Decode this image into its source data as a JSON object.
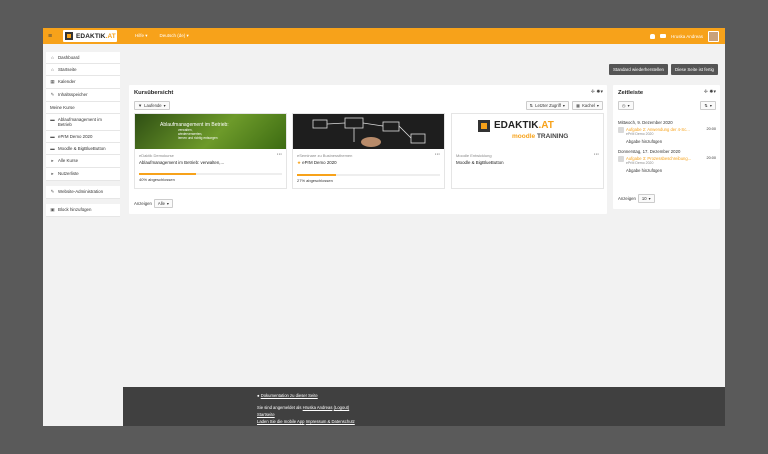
{
  "header": {
    "brand_main": "EDAKTIK",
    "brand_dot": ".AT",
    "menu": [
      "Hilfe ▾",
      "Deutsch (de) ▾"
    ],
    "user_name": "Hruska Andreas"
  },
  "sidebar": {
    "items": [
      {
        "icon": "⌂",
        "label": "Dashboard"
      },
      {
        "icon": "⌂",
        "label": "Startseite"
      },
      {
        "icon": "▦",
        "label": "Kalender"
      },
      {
        "icon": "✎",
        "label": "Inhaltsspeicher"
      },
      {
        "icon": "",
        "label": "Meine Kurse"
      },
      {
        "icon": "▬",
        "label": "Ablaufmanagement im Betrieb"
      },
      {
        "icon": "▬",
        "label": "ePrM Demo 2020"
      },
      {
        "icon": "▬",
        "label": "Moodle & BigBlueButton"
      },
      {
        "icon": "▸",
        "label": "Alle Kurse"
      },
      {
        "icon": "▸",
        "label": "Nutzerliste"
      },
      {
        "icon": "✎",
        "label": "Website-Administration"
      },
      {
        "icon": "▣",
        "label": "Block hinzufügen"
      }
    ]
  },
  "top_buttons": {
    "reset": "Standard wiederherstellen",
    "done": "Diese Seite ist fertig"
  },
  "overview": {
    "title": "Kursübersicht",
    "filter": "Laufende",
    "sort": "Letzter Zugriff",
    "view": "Kachel",
    "show_label": "Anzeigen",
    "show_value": "Alle",
    "courses": [
      {
        "category": "eDaktik Demokurse",
        "name": "Ablaufmanagement im Betrieb: verwalten,...",
        "percent_label": "40% abgeschlossen",
        "progress": 0.4,
        "img_text": "Ablaufmanagement im Betrieb:",
        "img_sub1": "verwalten,",
        "img_sub2": "wiederverwerten,",
        "img_sub3": "lernen und richtig entsorgen"
      },
      {
        "category": "eSeminare zu Businessthemen",
        "name": "ePrM Demo 2020",
        "percent_label": "27% abgeschlossen",
        "progress": 0.27
      },
      {
        "category": "Moodle Entwicklung",
        "name": "Moodle & BigBlueButton",
        "logo_main": "EDAKTIK",
        "logo_dot": ".AT",
        "logo_moodle": "moodle",
        "logo_training": "TRAINING"
      }
    ]
  },
  "timeline": {
    "title": "Zeitleiste",
    "show_label": "Anzeigen",
    "show_value": "10",
    "groups": [
      {
        "date": "Mittwoch, 9. Dezember 2020",
        "link": "Aufgabe 2: Anwendung der 4-Sc...",
        "time": "20:00",
        "course": "ePrM Demo 2020",
        "action": "Abgabe hinzufügen"
      },
      {
        "date": "Donnerstag, 17. Dezember 2020",
        "link": "Aufgabe 3: Prozessbeschreibung...",
        "time": "20:00",
        "course": "ePrM Demo 2020",
        "action": "Abgabe hinzufügen"
      }
    ]
  },
  "footer": {
    "doc_link": "Dokumentation zu dieser Seite",
    "logged_prefix": "Sie sind angemeldet als",
    "logged_user": "Hruska Andreas",
    "logout": "(Logout)",
    "home": "Startseite",
    "app_line": "Laden Sie die mobile App",
    "imprint": "Impressum & Datenschutz"
  }
}
